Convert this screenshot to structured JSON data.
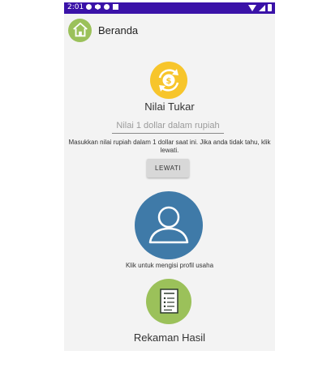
{
  "status_bar": {
    "time": "2:01",
    "icons": [
      "gear-icon",
      "shield-icon",
      "at-icon",
      "sd-card-icon",
      "wifi-icon",
      "signal-icon",
      "battery-icon"
    ]
  },
  "app_bar": {
    "title": "Beranda",
    "icon": "home-icon"
  },
  "exchange": {
    "title": "Nilai Tukar",
    "input_placeholder": "Nilai 1 dollar dalam rupiah",
    "input_value": "",
    "hint": "Masukkan nilai rupiah dalam 1 dollar saat ini. Jika anda tidak tahu, klik lewati.",
    "skip_label": "LEWATI",
    "icon": "currency-exchange-icon"
  },
  "profile": {
    "caption": "Klik untuk mengisi profil usaha",
    "icon": "user-icon"
  },
  "records": {
    "title": "Rekaman Hasil",
    "icon": "document-icon"
  },
  "colors": {
    "status_bar": "#3a12a8",
    "green": "#9bc15a",
    "yellow": "#f7c52b",
    "blue": "#3f7aa8",
    "background": "#f3f3f3"
  }
}
